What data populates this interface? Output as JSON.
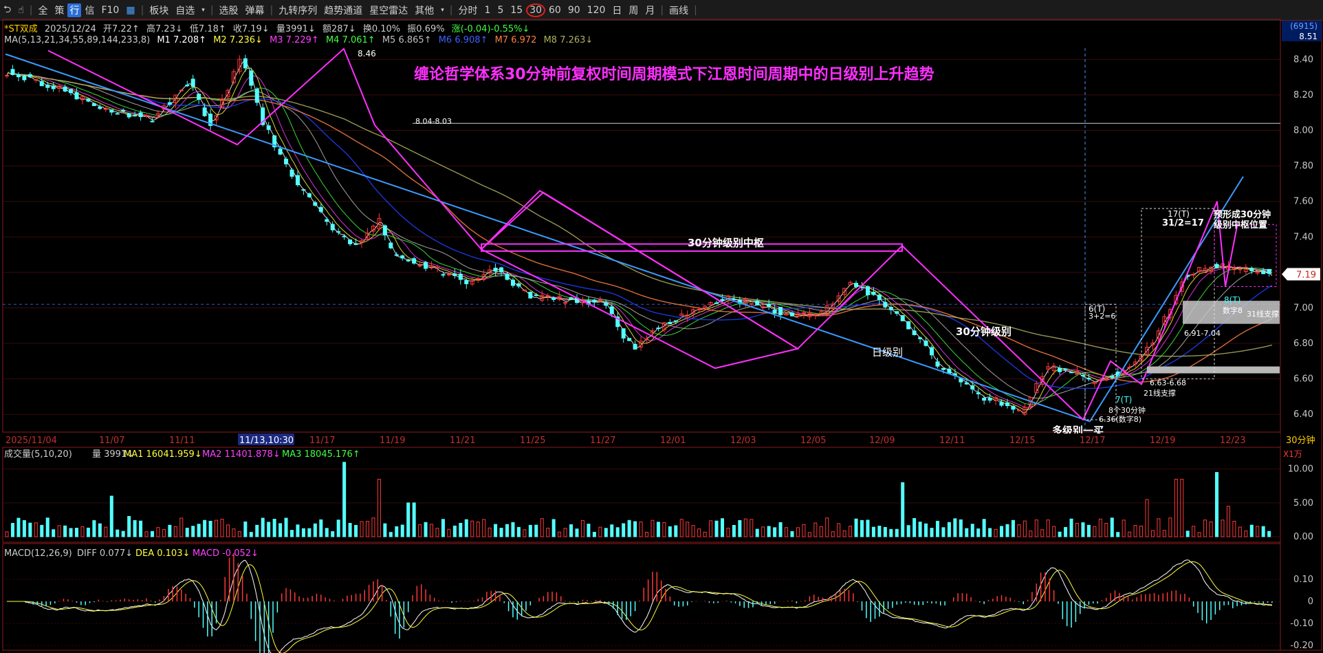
{
  "toolbar": {
    "items": [
      "全",
      "策",
      "行",
      "信",
      "F10",
      "板块",
      "自选",
      "选股",
      "弹幕",
      "九转序列",
      "趋势通道",
      "星空雷达",
      "其他",
      "分时",
      "1",
      "5",
      "15",
      "30",
      "60",
      "90",
      "120",
      "日",
      "周",
      "月",
      "画线"
    ],
    "active_item": "行",
    "selected_period": "30"
  },
  "header": {
    "name": "*ST双成",
    "date": "2025/12/24",
    "open": "开7.22↑",
    "high": "高7.23↓",
    "low": "低7.18↑",
    "close": "收7.19↓",
    "volume": "量3991↓",
    "amount": "额287↓",
    "turnover": "换0.10%",
    "amplitude": "振0.69%",
    "change": "涨(-0.04)-0.55%↓"
  },
  "ma_line": {
    "label": "MA(5,13,21,34,55,89,144,233,8)",
    "values": [
      "M1 7.208↑",
      "M2 7.236↓",
      "M3 7.229↑",
      "M4 7.061↑",
      "M5 6.865↑",
      "M6 6.908↑",
      "M7 6.972",
      "M8 7.263↓"
    ],
    "colors": [
      "#ffffff",
      "#ffff40",
      "#ff40ff",
      "#40ff40",
      "#c0c0c0",
      "#4040ff",
      "#ff8040",
      "#b0b060"
    ]
  },
  "annotations": {
    "title": "缠论哲学体系30分钟前复权时间周期模式下江恩时间周期中的日级别上升趋势",
    "zhongshu": "30分钟级别中枢",
    "daily": "日级别",
    "min30": "30分钟级别",
    "multi": "多级别一买",
    "high": "8.46",
    "price_band": "8.04-8.03",
    "low": "6.36(数字8)",
    "t6": "6(T)",
    "t6b": "3+2=6",
    "t7": "7(T)",
    "t7b": "8个30分钟",
    "t17": "17(T)",
    "t17b": "31/2=17",
    "t8": "8(T)",
    "t8b": "数字8",
    "rng1": "6.63-6.68",
    "rng2": "6.91-7.04",
    "sup21": "21线支撑",
    "sup31": "31线支撑",
    "form1": "预形成30分钟",
    "form2": "级别中枢位置"
  },
  "price_axis": {
    "labels": [
      "8.40",
      "8.20",
      "8.00",
      "7.80",
      "7.60",
      "7.40",
      "7.20",
      "7.00",
      "6.80",
      "6.60",
      "6.40"
    ],
    "current": "7.19",
    "top_code": "(6915)",
    "top_price": "8.51"
  },
  "date_axis": {
    "labels": [
      "2025/11/04",
      "11/07",
      "11/11",
      "11/13,10:30",
      "11/17",
      "11/19",
      "11/21",
      "11/25",
      "11/27",
      "12/01",
      "12/03",
      "12/05",
      "12/09",
      "12/11",
      "12/15",
      "12/17",
      "12/19",
      "12/23"
    ],
    "period": "30分钟"
  },
  "volume": {
    "label": "成交量(5,10,20)",
    "v": "量 3991↓",
    "ma1": "MA1 16041.959↓",
    "ma2": "MA2 11401.878↓",
    "ma3": "MA3 18045.176↑",
    "unit": "X1万",
    "axis": [
      "10.00",
      "5.00",
      "0.00"
    ]
  },
  "macd": {
    "label": "MACD(12,26,9)",
    "diff": "DIFF 0.077↓",
    "dea": "DEA 0.103↓",
    "macd": "MACD -0.052↓",
    "axis": [
      "0.10",
      "0",
      "-0.10",
      "-0.20"
    ]
  },
  "colors": {
    "up": "#ff3838",
    "down": "#54ffff",
    "zs": "#ff30ff",
    "trend": "#3a9bff",
    "title": "#ff30ff"
  }
}
